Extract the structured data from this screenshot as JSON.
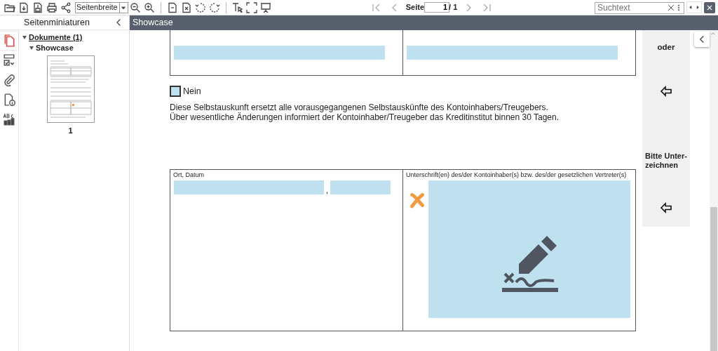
{
  "toolbar": {
    "zoom_select": "Seitenbreite",
    "page_label": "Seite",
    "page_input": "1",
    "page_total": "/ 1",
    "search": {
      "placeholder": "Suchtext"
    }
  },
  "sidebar": {
    "title": "Seitenminiaturen",
    "tabs": [
      {
        "selected": true
      },
      {
        "selected": false
      },
      {
        "selected": false
      },
      {
        "selected": false
      },
      {
        "selected": false
      }
    ],
    "tree": [
      {
        "label": "Dokumente (1)",
        "expanded": true,
        "children": [
          {
            "label": "Showcase",
            "expanded": true
          }
        ]
      }
    ],
    "thumbnail_label": "1"
  },
  "document": {
    "title": "Showcase",
    "checkbox": {
      "label": "Nein",
      "checked": false
    },
    "notice": [
      "Diese Selbstauskunft ersetzt alle vorausgegangenen Selbstauskünfte des Kontoinhabers/Treugebers.",
      "Über wesentliche Änderungen informiert der Kontoinhaber/Treugeber das Kreditinstitut binnen 30 Tagen."
    ],
    "place_date_label": "Ort, Datum",
    "comma": ",",
    "signature_label": "Unterschrift(en) des/der Kontoinhaber(s) bzw. des/der gesetzlichen Vertreter(s)",
    "side_hints": [
      "oder",
      "Bitte Unter-zeichnen"
    ]
  }
}
